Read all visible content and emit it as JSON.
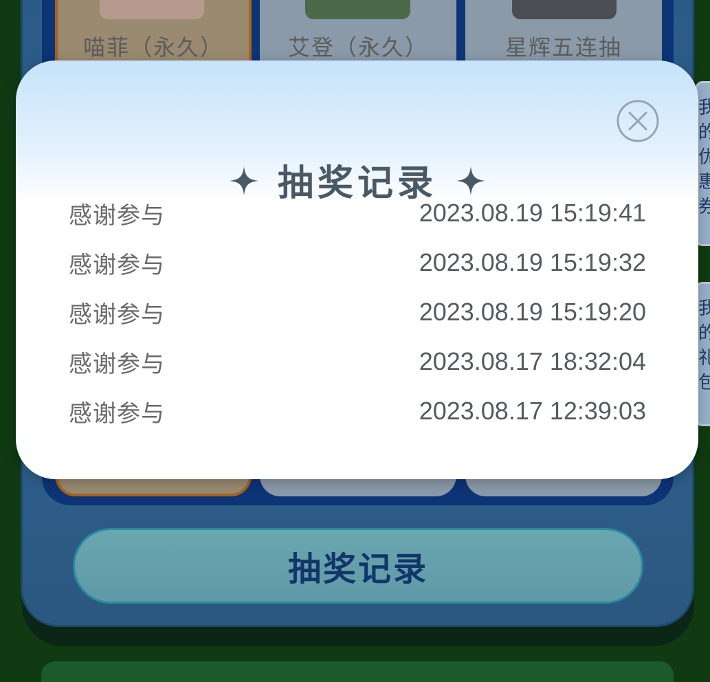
{
  "background": {
    "prizes": [
      {
        "name": "喵菲（永久）"
      },
      {
        "name": "艾登（永久）"
      },
      {
        "name": "星辉五连抽"
      }
    ],
    "record_button_label": "抽奖记录",
    "side_tabs": [
      {
        "text": "我的优惠券"
      },
      {
        "text": "我的礼包"
      }
    ]
  },
  "modal": {
    "title": "抽奖记录",
    "records": [
      {
        "result": "感谢参与",
        "time": "2023.08.19 15:19:41"
      },
      {
        "result": "感谢参与",
        "time": "2023.08.19 15:19:32"
      },
      {
        "result": "感谢参与",
        "time": "2023.08.19 15:19:20"
      },
      {
        "result": "感谢参与",
        "time": "2023.08.17 18:32:04"
      },
      {
        "result": "感谢参与",
        "time": "2023.08.17 12:39:03"
      }
    ]
  },
  "icons": {
    "sparkle": "sparkle-icon",
    "close": "close-icon"
  },
  "colors": {
    "title": "#4a5966",
    "button_label": "#12356a",
    "close_stroke": "#9aa4ae"
  }
}
